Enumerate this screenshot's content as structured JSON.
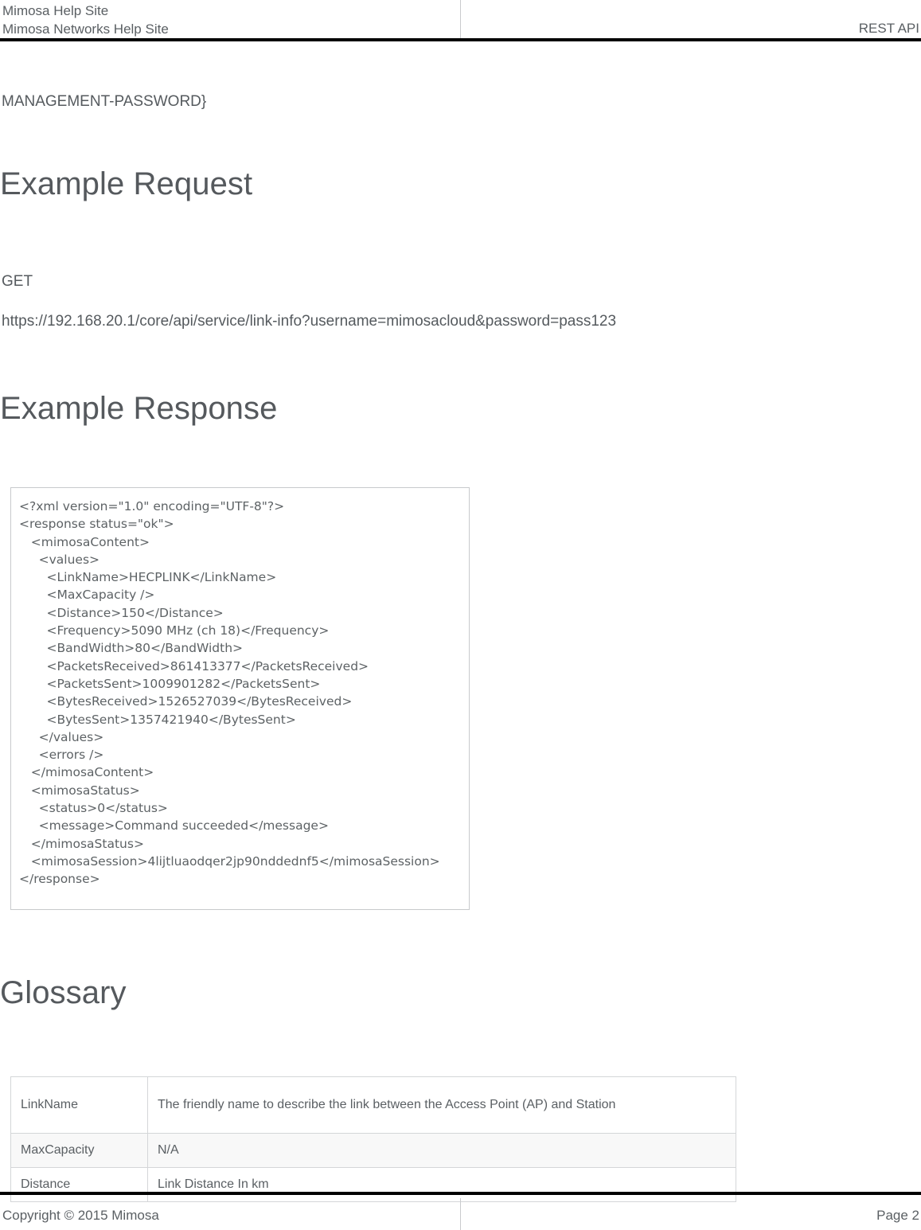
{
  "header": {
    "title_line_1": "Mimosa Help Site",
    "title_line_2": "Mimosa Networks Help Site",
    "section": "REST API"
  },
  "body": {
    "management_password_fragment": "MANAGEMENT-PASSWORD}",
    "heading_example_request": "Example Request",
    "http_method": "GET",
    "request_url": "https://192.168.20.1/core/api/service/link-info?username=mimosacloud&password=pass123",
    "heading_example_response": "Example Response",
    "response_xml": "<?xml version=\"1.0\" encoding=\"UTF-8\"?>\n<response status=\"ok\">\n   <mimosaContent>\n     <values>\n       <LinkName>HECPLINK</LinkName>\n       <MaxCapacity />\n       <Distance>150</Distance>\n       <Frequency>5090 MHz (ch 18)</Frequency>\n       <BandWidth>80</BandWidth>\n       <PacketsReceived>861413377</PacketsReceived>\n       <PacketsSent>1009901282</PacketsSent>\n       <BytesReceived>1526527039</BytesReceived>\n       <BytesSent>1357421940</BytesSent>\n     </values>\n     <errors />\n   </mimosaContent>\n   <mimosaStatus>\n     <status>0</status>\n     <message>Command succeeded</message>\n   </mimosaStatus>\n   <mimosaSession>4lijtluaodqer2jp90nddednf5</mimosaSession>\n</response>",
    "heading_glossary": "Glossary"
  },
  "glossary": {
    "rows": [
      {
        "term": "LinkName",
        "definition": "The friendly name to describe the link between the Access Point (AP) and Station",
        "shaded": false,
        "tall": true
      },
      {
        "term": "MaxCapacity",
        "definition": "N/A",
        "shaded": true,
        "tall": false
      },
      {
        "term": "Distance",
        "definition": "Link Distance In km",
        "shaded": false,
        "tall": false
      }
    ]
  },
  "footer": {
    "copyright": "Copyright © 2015 Mimosa",
    "page_label": "Page 2"
  },
  "colors": {
    "text": "#555a5e",
    "rule": "#000000",
    "border": "#c8cacc",
    "table_border": "#d4d6d8",
    "shaded_row": "#f8f8f8"
  }
}
